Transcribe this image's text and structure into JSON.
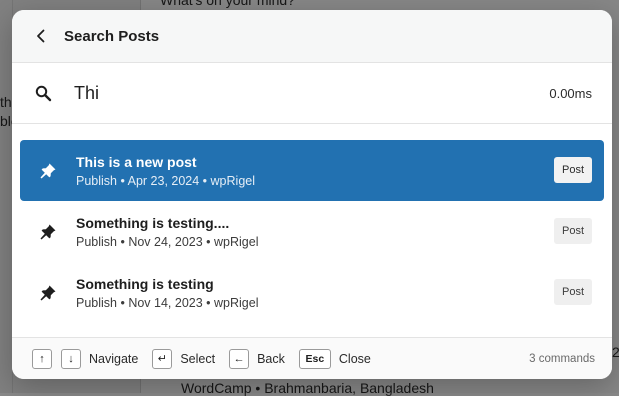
{
  "background": {
    "top_text": "What's on your mind?",
    "left_fragment_1": "th",
    "left_fragment_2": "ble",
    "bottom_text": "WordCamp • Brahmanbaria, Bangladesh",
    "right_fragment": "2("
  },
  "header": {
    "back_icon": "chevron-left-icon",
    "title": "Search Posts"
  },
  "search": {
    "icon": "search-icon",
    "value": "Thi",
    "timing": "0.00ms"
  },
  "results": [
    {
      "title": "This is a new post",
      "meta": "Publish • Apr 23, 2024 • wpRigel",
      "badge": "Post",
      "icon": "pin-icon",
      "active": true
    },
    {
      "title": "Something is testing....",
      "meta": "Publish • Nov 24, 2023 • wpRigel",
      "badge": "Post",
      "icon": "pin-icon",
      "active": false
    },
    {
      "title": "Something is testing",
      "meta": "Publish • Nov 14, 2023 • wpRigel",
      "badge": "Post",
      "icon": "pin-icon",
      "active": false
    }
  ],
  "footer": {
    "navigate_keys": [
      "↑",
      "↓"
    ],
    "navigate_label": "Navigate",
    "select_key": "↵",
    "select_label": "Select",
    "back_key": "←",
    "back_label": "Back",
    "esc_key": "Esc",
    "close_label": "Close",
    "commands": "3 commands"
  },
  "colors": {
    "accent": "#2271b1",
    "overlay": "rgba(0,0,0,0.45)"
  }
}
